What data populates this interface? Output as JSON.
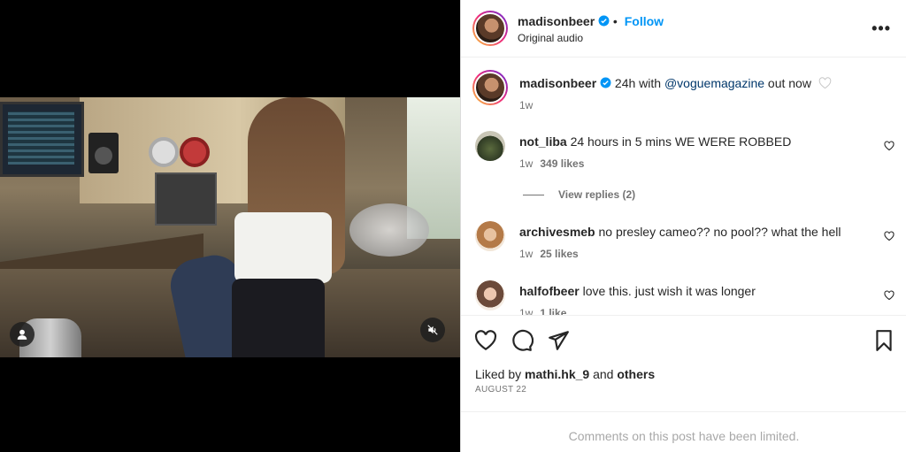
{
  "post": {
    "username": "madisonbeer",
    "follow_label": "Follow",
    "audio": "Original audio",
    "more_label": "•••"
  },
  "caption": {
    "username": "madisonbeer",
    "text_before": "24h with ",
    "mention": "@voguemagazine",
    "text_after": " out now",
    "time": "1w"
  },
  "comments": [
    {
      "username": "not_liba",
      "text": "24 hours in 5 mins WE WERE ROBBED",
      "time": "1w",
      "likes": "349 likes"
    },
    {
      "username": "archivesmeb",
      "text": "no presley cameo?? no pool?? what the hell",
      "time": "1w",
      "likes": "25 likes"
    },
    {
      "username": "halfofbeer",
      "text": "love this. just wish it was longer",
      "time": "1w",
      "likes": "1 like"
    }
  ],
  "view_replies": "View replies (2)",
  "footer": {
    "liked_by_prefix": "Liked by ",
    "liked_by_user": "mathi.hk_9",
    "liked_by_and": " and ",
    "liked_by_others": "others",
    "date": "AUGUST 22",
    "limited_notice": "Comments on this post have been limited."
  },
  "colors": {
    "accent": "#0095f6",
    "verified": "#0095f6",
    "muted": "#737373"
  }
}
